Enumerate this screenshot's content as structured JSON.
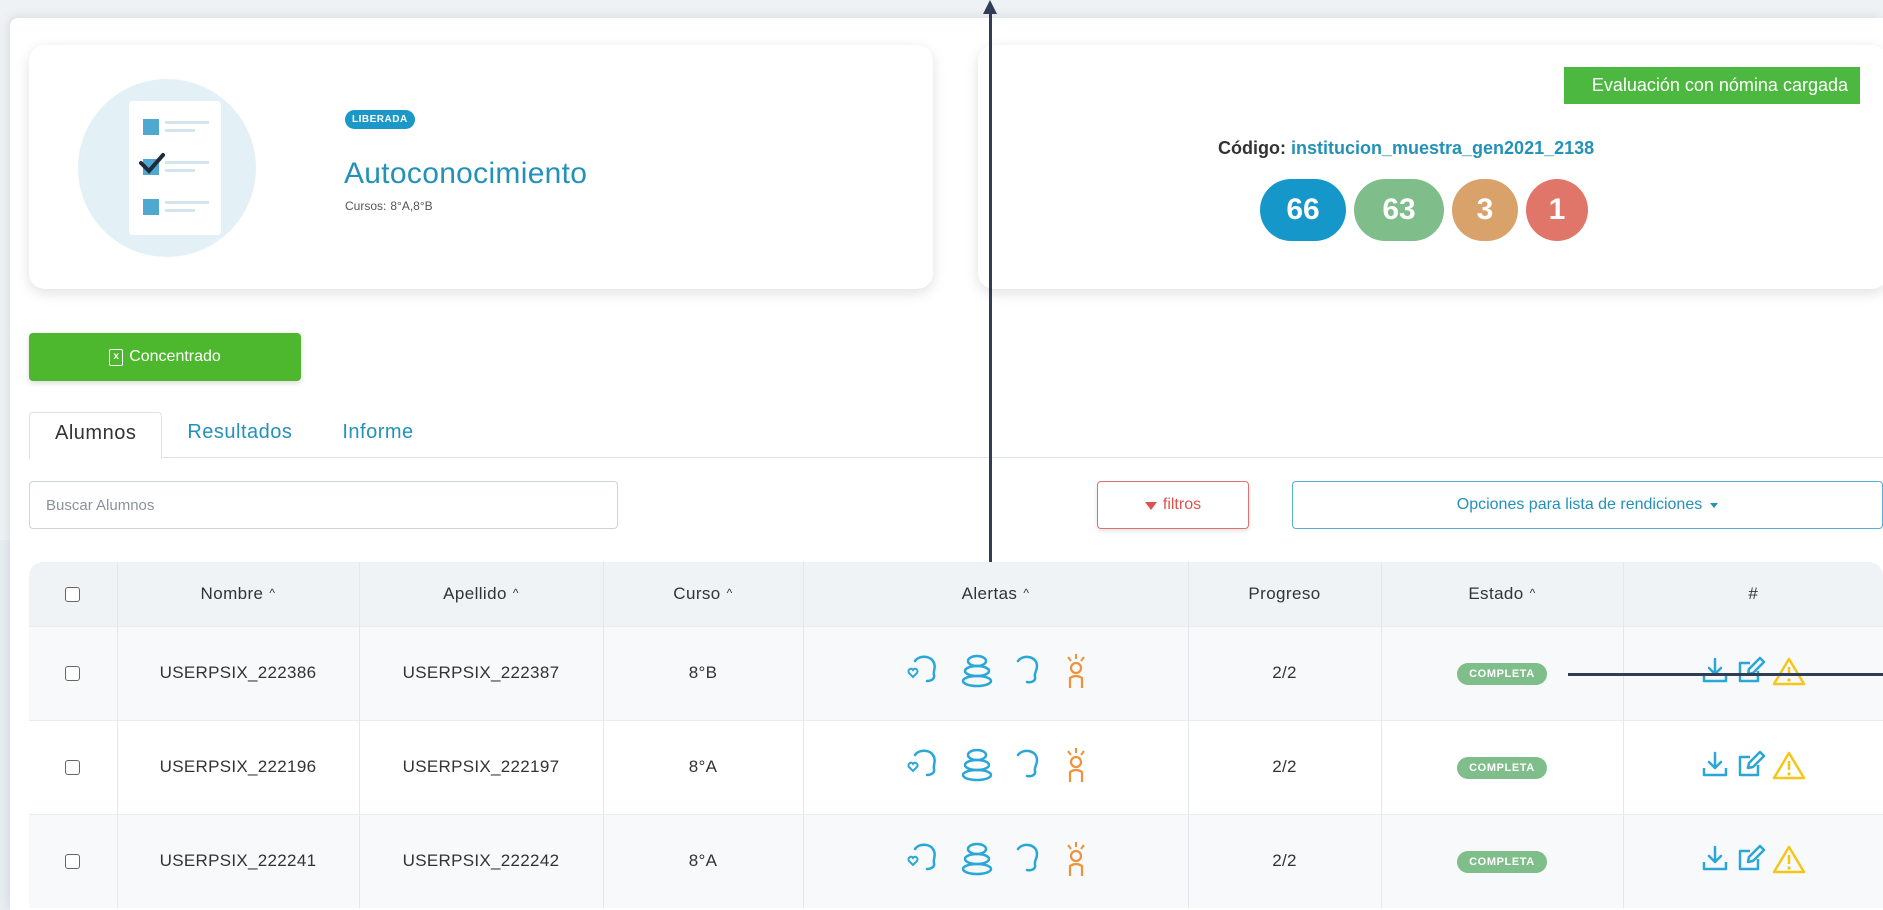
{
  "evaluation": {
    "status_badge": "LIBERADA",
    "title": "Autoconocimiento",
    "cursos_label": "Cursos:",
    "cursos_value": "8°A,8°B"
  },
  "summary": {
    "banner": "Evaluación con nómina cargada",
    "codigo_label": "Código:",
    "codigo_value": "institucion_muestra_gen2021_2138",
    "counts": [
      "66",
      "63",
      "3",
      "1"
    ],
    "count_colors": [
      "#1598c9",
      "#7fbd8a",
      "#d8a26a",
      "#e0756a"
    ]
  },
  "actions": {
    "concentrado_label": "Concentrado"
  },
  "tabs": [
    {
      "label": "Alumnos",
      "active": true
    },
    {
      "label": "Resultados",
      "active": false
    },
    {
      "label": "Informe",
      "active": false
    }
  ],
  "search": {
    "placeholder": "Buscar Alumnos",
    "value": ""
  },
  "filters": {
    "filtros_label": "filtros",
    "opciones_label": "Opciones para lista de rendiciones"
  },
  "table": {
    "headers": {
      "nombre": "Nombre",
      "apellido": "Apellido",
      "curso": "Curso",
      "alertas": "Alertas",
      "progreso": "Progreso",
      "estado": "Estado",
      "acciones": "#"
    },
    "sort_glyph": "^",
    "rows": [
      {
        "nombre": "USERPSIX_222386",
        "apellido": "USERPSIX_222387",
        "curso": "8°B",
        "progreso": "2/2",
        "estado": "COMPLETA"
      },
      {
        "nombre": "USERPSIX_222196",
        "apellido": "USERPSIX_222197",
        "curso": "8°A",
        "progreso": "2/2",
        "estado": "COMPLETA"
      },
      {
        "nombre": "USERPSIX_222241",
        "apellido": "USERPSIX_222242",
        "curso": "8°A",
        "progreso": "2/2",
        "estado": "COMPLETA"
      }
    ],
    "alert_icons": [
      "head-heart-icon",
      "stacked-stones-icon",
      "head-profile-icon",
      "person-alert-icon"
    ],
    "action_icons": [
      "download-icon",
      "edit-icon",
      "warning-icon"
    ]
  },
  "colors": {
    "accent_blue": "#2391b8",
    "green": "#4db82e",
    "status_green": "#7fbd8a",
    "filter_red": "#d9534f",
    "alert_blue": "#2aa7d6",
    "alert_orange": "#f0923a",
    "warning_yellow": "#f5c518"
  }
}
